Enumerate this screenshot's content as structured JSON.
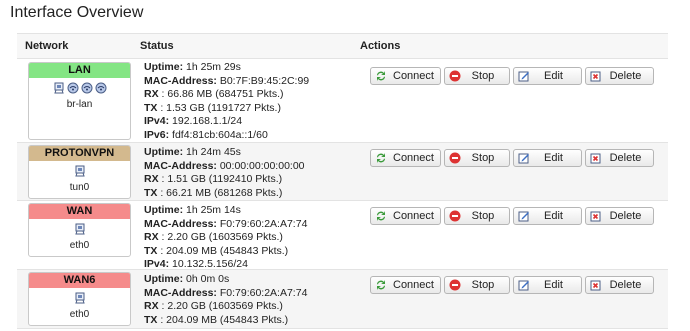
{
  "page": {
    "title": "Interface Overview"
  },
  "table": {
    "headers": {
      "network": "Network",
      "status": "Status",
      "actions": "Actions"
    }
  },
  "buttons": {
    "connect": "Connect",
    "stop": "Stop",
    "edit": "Edit",
    "delete": "Delete"
  },
  "interfaces": [
    {
      "name": "LAN",
      "device": "br-lan",
      "color": "#84e584",
      "icon": "bridge-icon",
      "status": [
        {
          "label": "Uptime:",
          "value": "1h 25m 29s"
        },
        {
          "label": "MAC-Address:",
          "value": "B0:7F:B9:45:2C:99"
        },
        {
          "label": "RX",
          "value": ": 66.86 MB (684751 Pkts.)"
        },
        {
          "label": "TX",
          "value": ": 1.53 GB (1191727 Pkts.)"
        },
        {
          "label": "IPv4:",
          "value": "192.168.1.1/24"
        },
        {
          "label": "IPv6:",
          "value": "fdf4:81cb:604a::1/60"
        }
      ]
    },
    {
      "name": "PROTONVPN",
      "device": "tun0",
      "color": "#d3b98e",
      "icon": "ethernet-port-icon",
      "status": [
        {
          "label": "Uptime:",
          "value": "1h 24m 45s"
        },
        {
          "label": "MAC-Address:",
          "value": "00:00:00:00:00:00"
        },
        {
          "label": "RX",
          "value": ": 1.51 GB (1192410 Pkts.)"
        },
        {
          "label": "TX",
          "value": ": 66.21 MB (681268 Pkts.)"
        }
      ]
    },
    {
      "name": "WAN",
      "device": "eth0",
      "color": "#f58b8b",
      "icon": "ethernet-port-icon",
      "status": [
        {
          "label": "Uptime:",
          "value": "1h 25m 14s"
        },
        {
          "label": "MAC-Address:",
          "value": "F0:79:60:2A:A7:74"
        },
        {
          "label": "RX",
          "value": ": 2.20 GB (1603569 Pkts.)"
        },
        {
          "label": "TX",
          "value": ": 204.09 MB (454843 Pkts.)"
        },
        {
          "label": "IPv4:",
          "value": "10.132.5.156/24"
        }
      ]
    },
    {
      "name": "WAN6",
      "device": "eth0",
      "color": "#f58b8b",
      "icon": "ethernet-port-icon",
      "status": [
        {
          "label": "Uptime:",
          "value": "0h 0m 0s"
        },
        {
          "label": "MAC-Address:",
          "value": "F0:79:60:2A:A7:74"
        },
        {
          "label": "RX",
          "value": ": 2.20 GB (1603569 Pkts.)"
        },
        {
          "label": "TX",
          "value": ": 204.09 MB (454843 Pkts.)"
        }
      ]
    }
  ]
}
